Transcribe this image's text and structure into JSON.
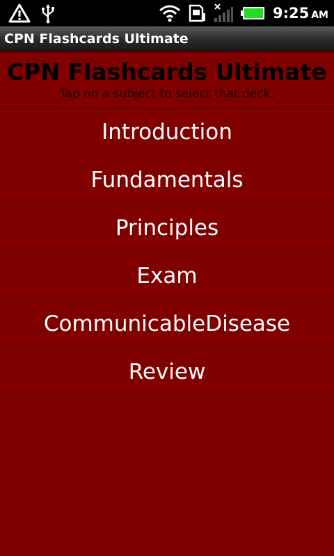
{
  "status_bar": {
    "time": "9:25",
    "ampm": "AM",
    "icons": [
      "warning-icon",
      "usb-icon",
      "wifi-icon",
      "sd-card-icon",
      "signal-icon",
      "battery-icon"
    ],
    "battery_color": "#22dd22"
  },
  "title_bar": {
    "title": "CPN Flashcards Ultimate"
  },
  "header": {
    "title": "CPN Flashcards Ultimate",
    "subtitle": "Tap on a subject to select that deck."
  },
  "decks": [
    {
      "label": "Introduction"
    },
    {
      "label": "Fundamentals"
    },
    {
      "label": "Principles"
    },
    {
      "label": "Exam"
    },
    {
      "label": "CommunicableDisease"
    },
    {
      "label": "Review"
    }
  ],
  "colors": {
    "background": "#800000",
    "divider": "#5a1010"
  }
}
